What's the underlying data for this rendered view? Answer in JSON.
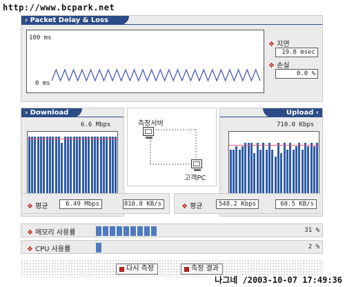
{
  "watermark": "http://www.bcpark.net",
  "footer_stamp": "나그네 /2003-10-07 17:49:36",
  "packet": {
    "tab_label": "› Packet Delay & Loss",
    "y_top_label": "100 ms",
    "y_bottom_label": "0 ms",
    "delay_label": "지연",
    "delay_value": "19.8 msec",
    "loss_label": "손실",
    "loss_value": "0.0 %",
    "wave_peaks": 24
  },
  "download": {
    "tab_label": "› Download",
    "rate_label": "6.6 Mbps",
    "avg_label": "평균",
    "avg_mbps": "6.49 Mbps",
    "avg_kbs": "810.8 KB/s",
    "bar_levels": [
      0.93,
      0.93,
      0.93,
      0.93,
      0.93,
      0.93,
      0.93,
      0.93,
      0.93,
      0.93,
      0.93,
      0.85,
      0.93,
      0.93,
      0.93,
      0.93,
      0.93,
      0.93,
      0.93,
      0.93,
      0.93,
      0.93,
      0.93,
      0.93,
      0.93,
      0.93,
      0.93,
      0.93,
      0.93,
      0.93
    ]
  },
  "upload": {
    "tab_label": "Upload ‹",
    "rate_label": "710.0 Kbps",
    "avg_label": "평균",
    "avg_mbps": "548.2 Kbps",
    "avg_kbs": "68.5 KB/s",
    "bar_levels": [
      0.75,
      0.75,
      0.8,
      0.75,
      0.8,
      0.85,
      0.85,
      0.85,
      0.7,
      0.85,
      0.75,
      0.85,
      0.75,
      0.85,
      0.75,
      0.65,
      0.85,
      0.7,
      0.85,
      0.75,
      0.85,
      0.75,
      0.8,
      0.85,
      0.75,
      0.85,
      0.8,
      0.85,
      0.8,
      0.85
    ]
  },
  "diagram": {
    "server_label": "측정서버",
    "client_label": "고객PC"
  },
  "memory": {
    "label": "메모리 사용률",
    "value": "31 %",
    "level": 0.31
  },
  "cpu": {
    "label": "CPU 사용률",
    "value": "2 %",
    "level": 0.02
  },
  "buttons": {
    "retest": "다시 측정",
    "result": "측정 결과"
  }
}
